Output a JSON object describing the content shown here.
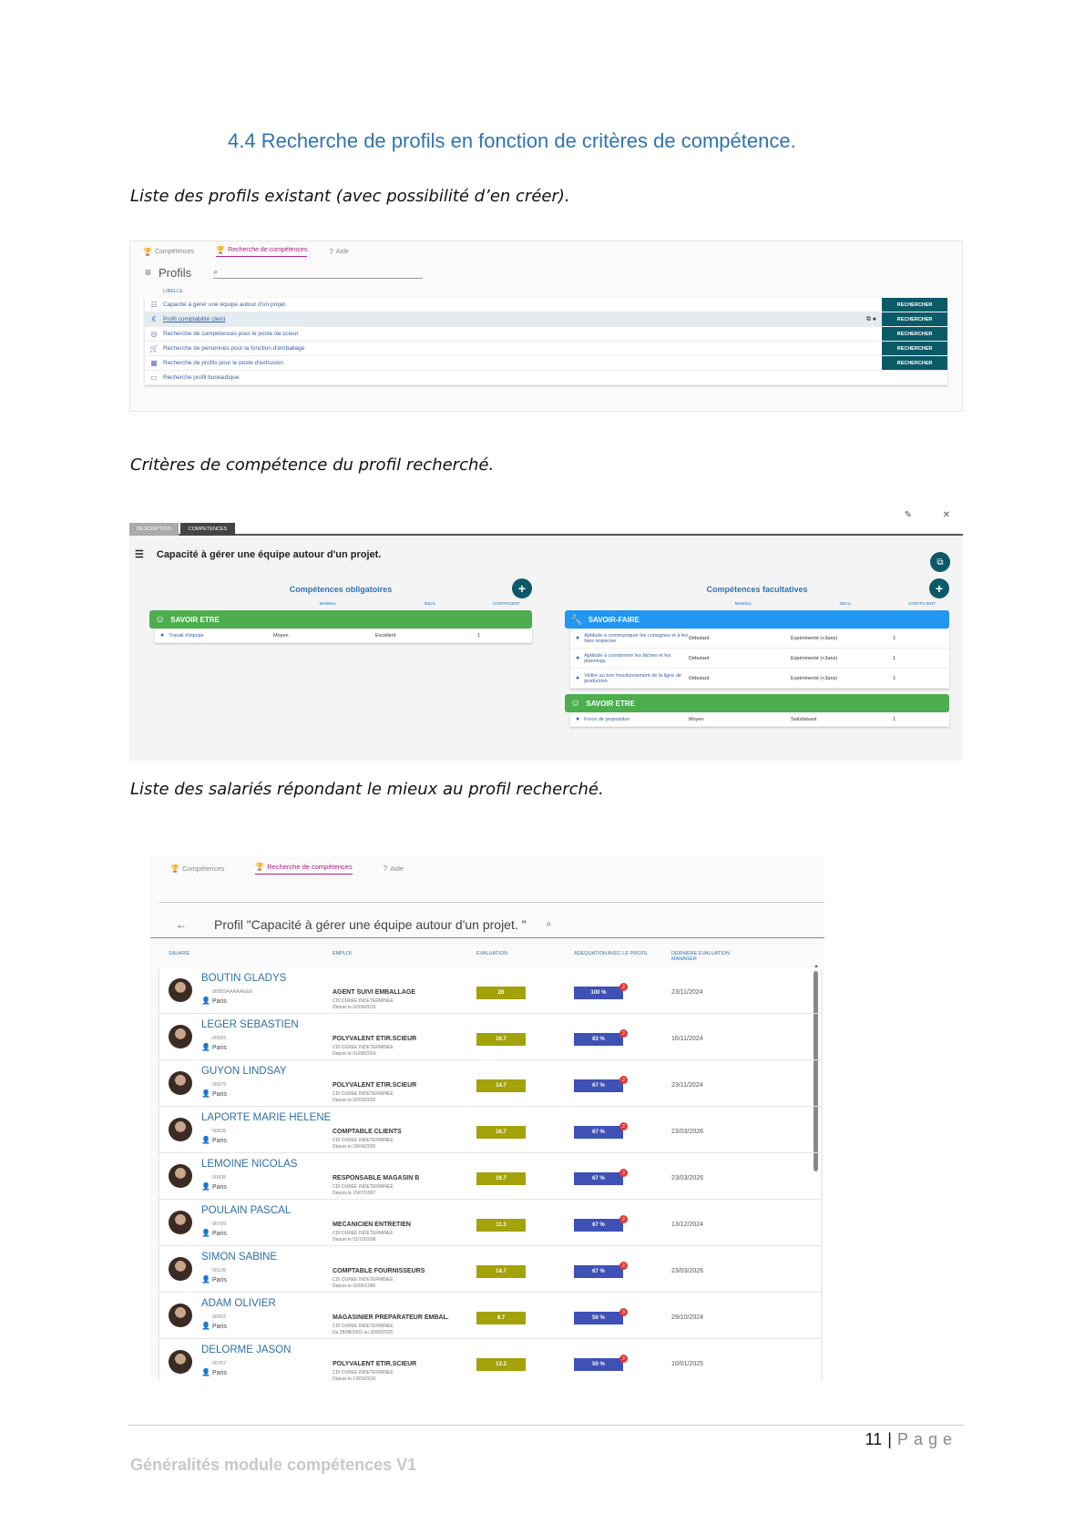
{
  "heading": "4.4 Recherche de profils en fonction de critères de compétence.",
  "captions": {
    "c1": "Liste des profils existant (avec possibilité d’en créer).",
    "c2": "Critères de compétence du profil recherché.",
    "c3": "Liste des salariés répondant le mieux au profil recherché."
  },
  "shot1": {
    "tabs": [
      "Compétences",
      "Recherche de compétences",
      "Aide"
    ],
    "title": "Profils",
    "libelle": "LIBELLE",
    "button_label": "RECHERCHER",
    "profiles": [
      {
        "label": "Capacité à gérer une équipe autour d'un projet",
        "icon": "list-icon"
      },
      {
        "label": "Profil comptabilité client",
        "icon": "euro-icon"
      },
      {
        "label": "Recherche de compétences pour le poste de scieur",
        "icon": "target-icon"
      },
      {
        "label": "Recherche de personnes pour la fonction d'emballage",
        "icon": "cart-icon"
      },
      {
        "label": "Recherche de profils pour le poste d'extrusion",
        "icon": "grid-icon"
      },
      {
        "label": "Recherche profil bureautique",
        "icon": "monitor-icon"
      }
    ]
  },
  "shot2": {
    "tabs": [
      "DESCRIPTION",
      "COMPETENCES"
    ],
    "title": "Capacité à gérer une équipe autour d'un projet.",
    "left_title": "Compétences obligatoires",
    "right_title": "Compétences facultatives",
    "col_headers": [
      "",
      "MINIMAL",
      "IDEAL",
      "COEFFICIENT"
    ],
    "left_groups": [
      {
        "name": "SAVOIR ETRE",
        "color": "#4cae4c",
        "items": [
          {
            "name": "Travail d'équipe",
            "min": "Moyen",
            "ideal": "Excellent",
            "coef": "1"
          }
        ]
      }
    ],
    "right_groups": [
      {
        "name": "SAVOIR-FAIRE",
        "color": "#2196f3",
        "items": [
          {
            "name": "Aptitude à communiquer les consignes et à les faire respecter",
            "min": "Débutant",
            "ideal": "Expérimenté (+3ans)",
            "coef": "1"
          },
          {
            "name": "Aptitude à coordonner les tâches et les plannings",
            "min": "Débutant",
            "ideal": "Expérimenté (+3ans)",
            "coef": "1"
          },
          {
            "name": "Veiller au bon fonctionnement de la ligne de production",
            "min": "Débutant",
            "ideal": "Expérimenté (+3ans)",
            "coef": "1"
          }
        ]
      },
      {
        "name": "SAVOIR ETRE",
        "color": "#4cae4c",
        "items": [
          {
            "name": "Force de proposition",
            "min": "Moyen",
            "ideal": "Satisfaisant",
            "coef": "1"
          }
        ]
      }
    ]
  },
  "shot3": {
    "tabs": [
      "Compétences",
      "Recherche de compétences",
      "Aide"
    ],
    "profile_title": "Profil \"Capacité à gérer une équipe autour d'un projet. \"",
    "columns": [
      "SALARIE",
      "EMPLOI",
      "EVALUATION",
      "ADEQUATION AVEC LE PROFIL",
      "DERNIERE EVALUATION MANAGER"
    ],
    "employees": [
      {
        "name": "BOUTIN GLADYS",
        "id": "00955AAAAAEEE",
        "city": "Paris",
        "job": "AGENT SUIVI EMBALLAGE",
        "contract": "CDI DUREE INDETERMINEE",
        "since": "Depuis le 02/09/2019",
        "eval": "20",
        "adq": "100 %",
        "badge": "2",
        "date": "23/11/2024"
      },
      {
        "name": "LEGER SEBASTIEN",
        "id": "00555",
        "city": "Paris",
        "job": "POLYVALENT ETIR.SCIEUR",
        "contract": "CDI DUREE INDETERMINEE",
        "since": "Depuis le 01/08/2024",
        "eval": "16.7",
        "adq": "83 %",
        "badge": "2",
        "date": "16/11/2024"
      },
      {
        "name": "GUYON LINDSAY",
        "id": "00975",
        "city": "Paris",
        "job": "POLYVALENT ETIR.SCIEUR",
        "contract": "CDI DUREE INDETERMINEE",
        "since": "Depuis le 02/03/2020",
        "eval": "14.7",
        "adq": "67 %",
        "badge": "2",
        "date": "23/11/2024"
      },
      {
        "name": "LAPORTE MARIE HELENE",
        "id": "00635",
        "city": "Paris",
        "job": "COMPTABLE CLIENTS",
        "contract": "CDI DUREE INDETERMINEE",
        "since": "Depuis le 18/04/2005",
        "eval": "16.7",
        "adq": "67 %",
        "badge": "2",
        "date": "23/03/2026"
      },
      {
        "name": "LEMOINE NICOLAS",
        "id": "00435",
        "city": "Paris",
        "job": "RESPONSABLE MAGASIN B",
        "contract": "CDI DUREE INDETERMINEE",
        "since": "Depuis le 15/07/1997",
        "eval": "16.7",
        "adq": "67 %",
        "badge": "2",
        "date": "23/03/2026"
      },
      {
        "name": "POULAIN PASCAL",
        "id": "00709",
        "city": "Paris",
        "job": "MECANICIEN ENTRETIEN",
        "contract": "CDI DUREE INDETERMINEE",
        "since": "Depuis le 01/10/2008",
        "eval": "11.3",
        "adq": "67 %",
        "badge": "2",
        "date": "13/12/2024"
      },
      {
        "name": "SIMON SABINE",
        "id": "00136",
        "city": "Paris",
        "job": "COMPTABLE FOURNISSEURS",
        "contract": "CDI DUREE INDETERMINEE",
        "since": "Depuis le 02/06/1986",
        "eval": "14.7",
        "adq": "67 %",
        "badge": "2",
        "date": "23/03/2026"
      },
      {
        "name": "ADAM OLIVIER",
        "id": "00001",
        "city": "Paris",
        "job": "MAGASINIER PREPARATEUR EMBAL.",
        "contract": "CDI DUREE INDETERMINEE",
        "since": "Du 28/08/2002 au 30/09/2025",
        "eval": "8.7",
        "adq": "50 %",
        "badge": "3",
        "date": "29/10/2024"
      },
      {
        "name": "DELORME JASON",
        "id": "00757",
        "city": "Paris",
        "job": "POLYVALENT ETIR.SCIEUR",
        "contract": "CDI DUREE INDETERMINEE",
        "since": "Depuis le 13/09/2016",
        "eval": "13.3",
        "adq": "50 %",
        "badge": "2",
        "date": "10/01/2025"
      }
    ]
  },
  "footer": {
    "page_number": "11",
    "separator": "|",
    "page_word": "Page",
    "doc_title": "Généralités module compétences V1"
  }
}
